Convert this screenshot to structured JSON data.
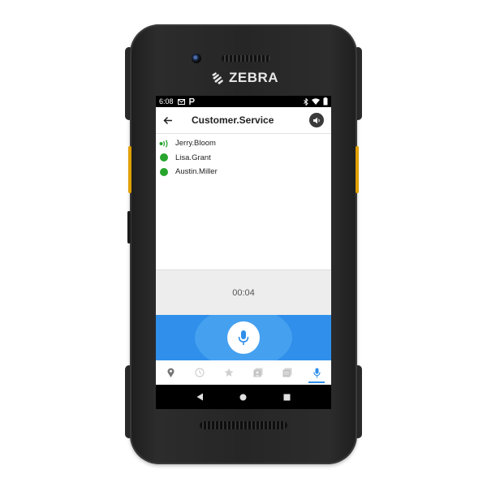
{
  "device": {
    "brand": "ZEBRA"
  },
  "statusbar": {
    "time": "6:08"
  },
  "appbar": {
    "title": "Customer.Service"
  },
  "members": [
    {
      "name": "Jerry.Bloom",
      "state": "talking"
    },
    {
      "name": "Lisa.Grant",
      "state": "online"
    },
    {
      "name": "Austin.Miller",
      "state": "online"
    }
  ],
  "timer": {
    "value": "00:04"
  },
  "tabs": [
    {
      "icon": "location-pin-icon",
      "active": false
    },
    {
      "icon": "history-clock-icon",
      "active": false
    },
    {
      "icon": "star-icon",
      "active": false
    },
    {
      "icon": "contacts-icon",
      "active": false
    },
    {
      "icon": "groups-icon",
      "active": false
    },
    {
      "icon": "microphone-icon",
      "active": true
    }
  ],
  "colors": {
    "accent": "#2f8fea",
    "online": "#27a52d",
    "talking": "#27a52d"
  }
}
